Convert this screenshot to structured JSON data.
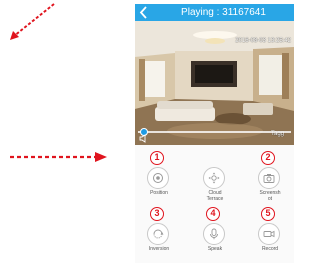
{
  "header": {
    "title": "Playing : 31167641"
  },
  "video": {
    "timestamp": "2016-08-03  13:25:42",
    "watermark": "Tagg",
    "playback_progress": 0.02
  },
  "controls": [
    {
      "badge": "1",
      "label": "Position",
      "icon": "position-icon"
    },
    {
      "badge": "",
      "label": "Cloud\nTerrace",
      "icon": "ptz-icon"
    },
    {
      "badge": "2",
      "label": "Screensh\not",
      "icon": "camera-icon"
    },
    {
      "badge": "3",
      "label": "Inversion",
      "icon": "inversion-icon"
    },
    {
      "badge": "4",
      "label": "Speak",
      "icon": "microphone-icon"
    },
    {
      "badge": "5",
      "label": "Record",
      "icon": "video-camera-icon"
    }
  ],
  "colors": {
    "title_bar": "#29a6e6",
    "badge_red": "#e0141e",
    "guide_arrow": "#e0141e"
  }
}
